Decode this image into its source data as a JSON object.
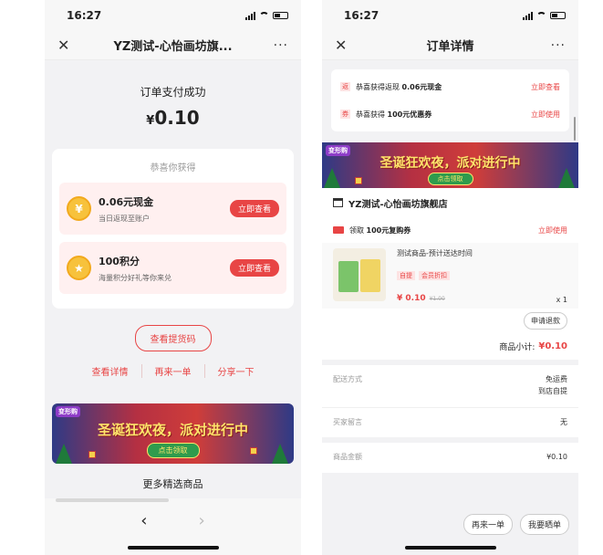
{
  "left": {
    "status": {
      "time": "16:27"
    },
    "nav": {
      "close": "✕",
      "title": "YZ测试-心怡画坊旗...",
      "more": "···"
    },
    "pay": {
      "status": "订单支付成功",
      "currency": "¥",
      "amount": "0.10"
    },
    "rewards": {
      "heading": "恭喜你获得",
      "items": [
        {
          "icon": "¥",
          "title": "0.06元现金",
          "sub": "当日返现至账户",
          "button": "立即查看"
        },
        {
          "icon": "★",
          "title": "100积分",
          "sub": "海量积分好礼等你来兑",
          "button": "立即查看"
        }
      ]
    },
    "pickup_button": "查看提货码",
    "links": [
      "查看详情",
      "再来一单",
      "分享一下"
    ],
    "banner": {
      "tag": "变形购",
      "slogan": "圣诞狂欢夜，派对进行中",
      "cta": "点击领取"
    },
    "more_title": "更多精选商品",
    "bottom_nav": {
      "back": "‹",
      "forward": "›"
    }
  },
  "right": {
    "status": {
      "time": "16:27"
    },
    "nav": {
      "close": "✕",
      "title": "订单详情",
      "more": "···"
    },
    "coupons": [
      {
        "tag": "返",
        "prefix": "恭喜获得返现 ",
        "value": "0.06元现金",
        "link": "立即查看"
      },
      {
        "tag": "券",
        "prefix": "恭喜获得 ",
        "value": "100元优惠券",
        "link": "立即使用"
      }
    ],
    "banner": {
      "tag": "变形购",
      "slogan": "圣诞狂欢夜，派对进行中",
      "cta": "点击领取"
    },
    "shop_name": "YZ测试-心怡画坊旗舰店",
    "shop_coupon": {
      "prefix": "领取 ",
      "value": "100元复购券",
      "link": "立即使用"
    },
    "product": {
      "name": "测试商品-预计送达时间",
      "tags": [
        "自提",
        "会员折扣"
      ],
      "price": "¥ 0.10",
      "old_price": "¥1.00",
      "qty": "x 1"
    },
    "refund_button": "申请退款",
    "subtotal": {
      "label": "商品小计:",
      "value": "¥0.10"
    },
    "delivery": {
      "label": "配送方式",
      "value1": "免运费",
      "value2": "到店自提"
    },
    "message": {
      "label": "买家留言",
      "value": "无"
    },
    "total": {
      "label": "商品金额",
      "value": "¥0.10"
    },
    "actions": [
      "再来一单",
      "我要晒单"
    ]
  },
  "colors": {
    "accent": "#e84545",
    "background": "#f2f2f4",
    "coin": "#f7c23c"
  }
}
